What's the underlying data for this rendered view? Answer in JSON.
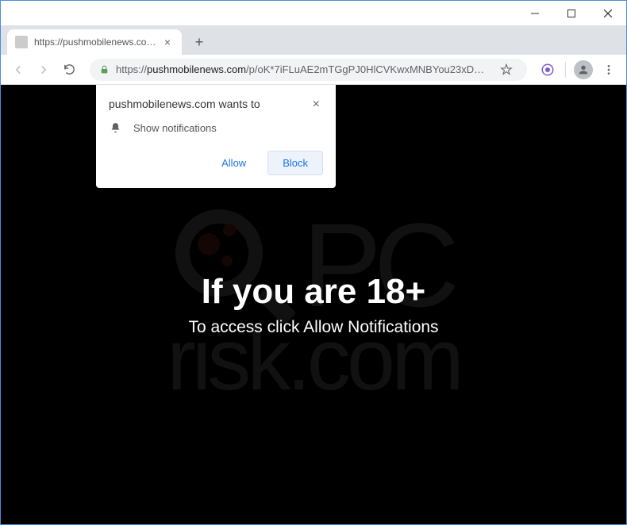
{
  "tab": {
    "title": "https://pushmobilenews.com/p/c"
  },
  "url": {
    "protocol": "https://",
    "host": "pushmobilenews.com",
    "path": "/p/oK*7iFLuAE2mTGgPJ0HlCVKwxMNBYou23xD…"
  },
  "permission": {
    "title": "pushmobilenews.com wants to",
    "item": "Show notifications",
    "allow": "Allow",
    "block": "Block"
  },
  "page": {
    "headline": "If you are 18+",
    "subline": "To access click Allow Notifications"
  },
  "watermark": {
    "pc": "PC",
    "risk": "risk.com"
  }
}
